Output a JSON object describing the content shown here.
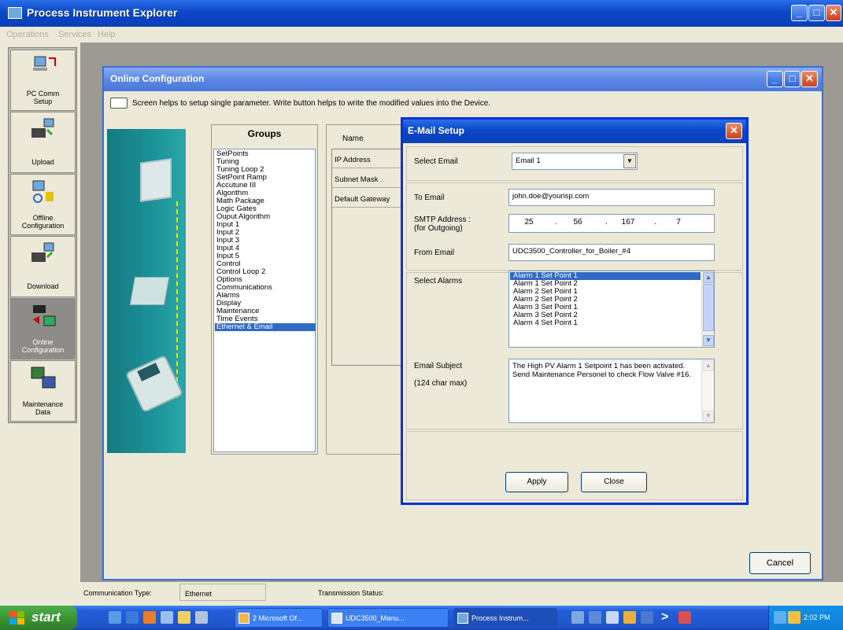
{
  "app": {
    "title": "Process Instrument Explorer",
    "menu": [
      "Operations",
      "Services",
      "Help"
    ]
  },
  "left_nav": [
    {
      "label": "PC Comm\nSetup",
      "icon": "pc-comm-icon"
    },
    {
      "label": "Upload",
      "icon": "upload-icon"
    },
    {
      "label": "Offline\nConfiguration",
      "icon": "offline-config-icon"
    },
    {
      "label": "Download",
      "icon": "download-icon"
    },
    {
      "label": "Online\nConfiguration",
      "icon": "online-config-icon",
      "active": true
    },
    {
      "label": "Maintenance\nData",
      "icon": "maintenance-data-icon"
    }
  ],
  "online_config": {
    "title": "Online Configuration",
    "help_text": "Screen helps to setup single parameter. Write button helps to write the modified values into the Device.",
    "groups_header": "Groups",
    "groups": [
      "SetPoints",
      "Tuning",
      "Tuning Loop 2",
      "SetPoint Ramp",
      "Accutune III",
      "Algorithm",
      "Math Package",
      "Logic Gates",
      "Ouput Algorithm",
      "Input 1",
      "Input 2",
      "Input 3",
      "Input 4",
      "Input 5",
      "Control",
      "Control Loop 2",
      "Options",
      "Communications",
      "Alarms",
      "Display",
      "Maintenance",
      "Time Events",
      "Ethernet & Email"
    ],
    "selected_group": "Ethernet & Email",
    "names_header": "Name",
    "names": [
      "IP Address",
      "Subnet Mask",
      "Default Gateway"
    ],
    "cancel_label": "Cancel"
  },
  "email_setup": {
    "title": "E-Mail Setup",
    "select_email_label": "Select Email",
    "select_email_value": "Email 1",
    "to_email_label": "To Email",
    "to_email_value": "john.doe@yourisp.com",
    "smtp_label": "SMTP Address :\n(for Outgoing)",
    "smtp_octets": [
      "25",
      "56",
      "167",
      "7"
    ],
    "from_email_label": "From Email",
    "from_email_value": "UDC3500_Controller_for_Boiler_#4",
    "select_alarms_label": "Select Alarms",
    "alarms": [
      "Alarm 1 Set Point 1",
      "Alarm 1 Set Point 2",
      "Alarm 2 Set Point 1",
      "Alarm 2 Set Point 2",
      "Alarm 3 Set Point 1",
      "Alarm 3 Set Point 2",
      "Alarm 4 Set Point 1"
    ],
    "selected_alarm": "Alarm 1 Set Point 1",
    "subject_label": "Email Subject",
    "subject_note": "(124 char max)",
    "subject_value": "The High PV Alarm 1 Setpoint 1 has been activated. Send Maintenance Personel to check Flow Valve #16.",
    "apply_label": "Apply",
    "close_label": "Close"
  },
  "status_bar": {
    "comm_type_label": "Communication Type:",
    "comm_type_value": "Ethernet",
    "transmission_label": "Transmission Status:"
  },
  "taskbar": {
    "start_label": "start",
    "tasks": [
      "2 Microsoft Of...",
      "UDC3500_Manu...",
      "Process Instrum..."
    ],
    "clock": "2:02 PM"
  }
}
